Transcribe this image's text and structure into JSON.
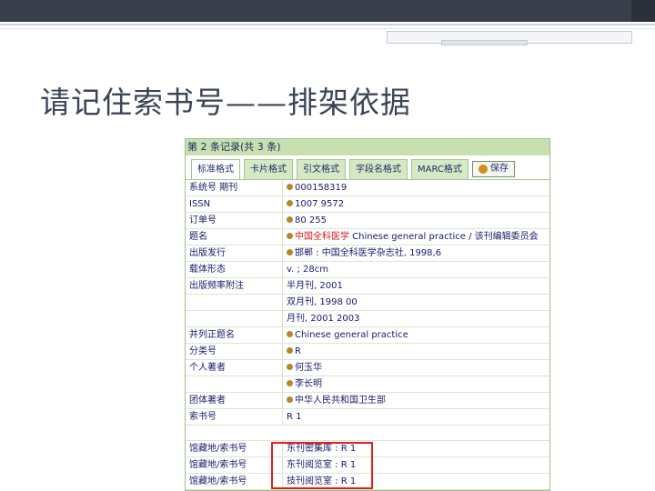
{
  "slide": {
    "title": "请记住索书号——排架依据"
  },
  "record": {
    "header": "第 2 条记录(共 3 条)",
    "tabs": [
      {
        "label": "标准格式",
        "active": true
      },
      {
        "label": "卡片格式",
        "active": false
      },
      {
        "label": "引文格式",
        "active": false
      },
      {
        "label": "字段名格式",
        "active": false
      },
      {
        "label": "MARC格式",
        "active": false
      }
    ],
    "save_label": "保存",
    "rows": [
      {
        "label": "系统号  期刊",
        "value": "000158319",
        "dot": true
      },
      {
        "label": "ISSN",
        "value": "1007 9572",
        "dot": true
      },
      {
        "label": "订单号",
        "value": "80 255",
        "dot": true
      },
      {
        "label": "题名",
        "value_red": "中国全科医学",
        "value": " Chinese general practice / 该刊编辑委员会",
        "dot": true
      },
      {
        "label": "出版发行",
        "value": "邯郸 : 中国全科医学杂志社, 1998,6",
        "dot": true
      },
      {
        "label": "载体形态",
        "value": "v. ; 28cm",
        "dot": false
      },
      {
        "label": "出版频率附注",
        "value": "半月刊, 2001",
        "dot": false
      },
      {
        "label": "",
        "value": "双月刊, 1998 00",
        "dot": false
      },
      {
        "label": "",
        "value": "月刊, 2001 2003",
        "dot": false
      },
      {
        "label": "并列正题名",
        "value": "Chinese general practice",
        "dot": true
      },
      {
        "label": "分类号",
        "value": "R",
        "dot": true
      },
      {
        "label": "个人著者",
        "value": "何玉华",
        "dot": true
      },
      {
        "label": "",
        "value": "李长明",
        "dot": true
      },
      {
        "label": "团体著者",
        "value": "中华人民共和国卫生部",
        "dot": true
      },
      {
        "label": "索书号",
        "value": "R 1",
        "dot": false
      }
    ],
    "holdings": [
      {
        "label": "馆藏地/索书号",
        "value": "东刊密集库 : R 1"
      },
      {
        "label": "馆藏地/索书号",
        "value": "东刊阅览室 : R 1"
      },
      {
        "label": "馆藏地/索书号",
        "value": "技刊阅览室 : R 1"
      }
    ]
  }
}
